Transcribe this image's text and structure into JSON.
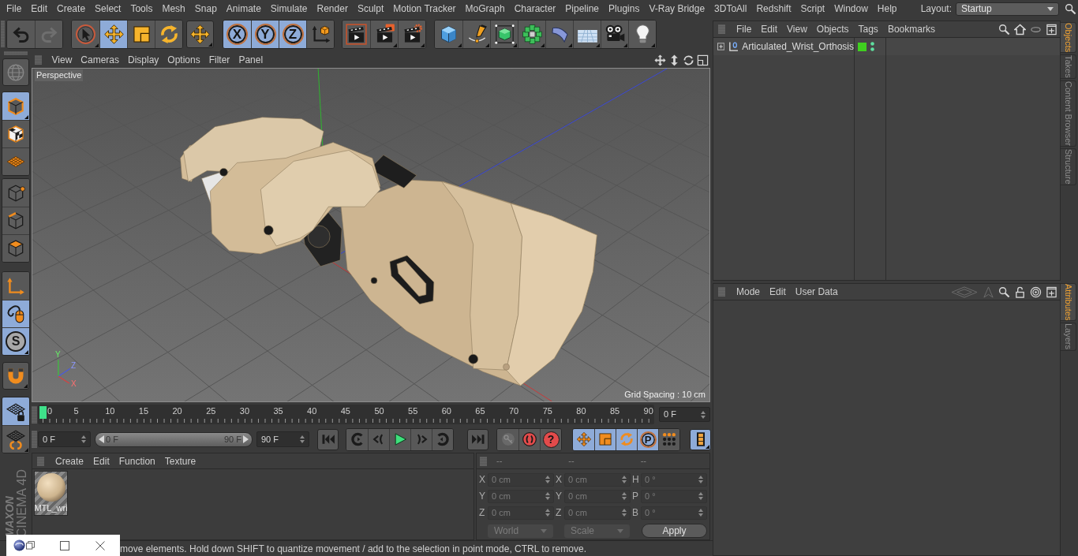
{
  "menu_bar": {
    "items": [
      "File",
      "Edit",
      "Create",
      "Select",
      "Tools",
      "Mesh",
      "Snap",
      "Animate",
      "Simulate",
      "Render",
      "Sculpt",
      "Motion Tracker",
      "MoGraph",
      "Character",
      "Pipeline",
      "Plugins",
      "V-Ray Bridge",
      "3DToAll",
      "Redshift",
      "Script",
      "Window",
      "Help"
    ],
    "layout_label": "Layout:",
    "layout_value": "Startup"
  },
  "toolbar": {
    "groups": [
      {
        "buttons": [
          {
            "kind": "undo",
            "selected": false,
            "disabled": false
          },
          {
            "kind": "redo",
            "selected": false,
            "disabled": true
          }
        ]
      },
      {
        "buttons": [
          {
            "kind": "live-select",
            "selected": false,
            "disabled": false
          },
          {
            "kind": "move",
            "selected": true,
            "disabled": false
          },
          {
            "kind": "scale",
            "selected": false,
            "disabled": false
          },
          {
            "kind": "rotate",
            "selected": false,
            "disabled": false
          }
        ]
      },
      {
        "buttons": [
          {
            "kind": "move-menu",
            "selected": false,
            "disabled": false
          }
        ]
      },
      {
        "buttons": [
          {
            "kind": "axis-lock",
            "label": "X",
            "selected": true,
            "disabled": false
          },
          {
            "kind": "axis-lock",
            "label": "Y",
            "selected": true,
            "disabled": false
          },
          {
            "kind": "axis-lock",
            "label": "Z",
            "selected": true,
            "disabled": false
          },
          {
            "kind": "coordinate-system",
            "selected": false,
            "disabled": false
          }
        ]
      },
      {
        "buttons": [
          {
            "kind": "render-view",
            "selected": false,
            "disabled": false
          },
          {
            "kind": "render-picture-viewer",
            "selected": false,
            "disabled": false
          },
          {
            "kind": "render-settings",
            "selected": false,
            "disabled": false
          }
        ]
      },
      {
        "buttons": [
          {
            "kind": "cube",
            "selected": false,
            "disabled": false
          },
          {
            "kind": "pen",
            "selected": false,
            "disabled": false
          },
          {
            "kind": "subdivision",
            "selected": false,
            "disabled": false
          },
          {
            "kind": "cloner",
            "selected": false,
            "disabled": false
          },
          {
            "kind": "deformer",
            "selected": false,
            "disabled": false
          },
          {
            "kind": "floor",
            "selected": false,
            "disabled": false
          },
          {
            "kind": "camera",
            "selected": false,
            "disabled": false
          },
          {
            "kind": "light",
            "selected": false,
            "disabled": false
          }
        ]
      }
    ]
  },
  "mode_toolbar": {
    "groups": [
      {
        "buttons": [
          {
            "kind": "make-editable",
            "selected": false,
            "disabled": true
          }
        ]
      },
      {
        "buttons": [
          {
            "kind": "model",
            "selected": true,
            "disabled": false
          },
          {
            "kind": "texture",
            "selected": false,
            "disabled": false
          },
          {
            "kind": "workplane",
            "selected": false,
            "disabled": false
          }
        ]
      },
      {
        "buttons": [
          {
            "kind": "points",
            "selected": false,
            "disabled": false
          },
          {
            "kind": "edges",
            "selected": false,
            "disabled": false
          },
          {
            "kind": "polygons",
            "selected": false,
            "disabled": false
          }
        ]
      },
      {
        "buttons": [
          {
            "kind": "axis",
            "selected": false,
            "disabled": false
          },
          {
            "kind": "tweak",
            "selected": true,
            "disabled": false
          },
          {
            "kind": "snap",
            "label": "S",
            "selected": true,
            "disabled": false
          }
        ]
      },
      {
        "buttons": [
          {
            "kind": "magnet",
            "selected": false,
            "disabled": false
          }
        ]
      },
      {
        "buttons": [
          {
            "kind": "workplane-lock",
            "selected": true,
            "disabled": false
          },
          {
            "kind": "workplane-rotate",
            "selected": false,
            "disabled": false
          }
        ]
      }
    ]
  },
  "logo": {
    "brand": "MAXON",
    "product": "CINEMA 4D"
  },
  "viewport": {
    "menus": [
      "View",
      "Cameras",
      "Display",
      "Options",
      "Filter",
      "Panel"
    ],
    "camera": "Perspective",
    "grid_spacing": "Grid Spacing : 10 cm",
    "axis_labels": {
      "y": "Y",
      "z": "Z",
      "x": "X"
    }
  },
  "timeline": {
    "frame_labels": [
      "0",
      "5",
      "10",
      "15",
      "20",
      "25",
      "30",
      "35",
      "40",
      "45",
      "50",
      "55",
      "60",
      "65",
      "70",
      "75",
      "80",
      "85",
      "90"
    ],
    "playhead": {
      "level": 0
    },
    "current_frame": "0 F"
  },
  "transport": {
    "start_frame": "0 F",
    "range_start": "0 F",
    "range_end": "90 F",
    "end_frame": "90 F",
    "groups": [
      {
        "buttons": [
          {
            "kind": "go-start",
            "selected": false,
            "disabled": false
          }
        ]
      },
      {
        "buttons": [
          {
            "kind": "prev-key",
            "selected": false,
            "disabled": false
          },
          {
            "kind": "prev-frame",
            "selected": false,
            "disabled": false
          },
          {
            "kind": "play",
            "selected": false,
            "disabled": false
          },
          {
            "kind": "next-frame",
            "selected": false,
            "disabled": false
          },
          {
            "kind": "next-key",
            "selected": false,
            "disabled": false
          }
        ]
      },
      {
        "buttons": [
          {
            "kind": "go-end",
            "selected": false,
            "disabled": false
          }
        ]
      },
      {
        "buttons": [
          {
            "kind": "record-key",
            "selected": false,
            "disabled": true
          },
          {
            "kind": "autokey",
            "selected": false,
            "disabled": false
          },
          {
            "kind": "help",
            "label": "?",
            "selected": false,
            "disabled": false
          }
        ]
      },
      {
        "buttons": [
          {
            "kind": "key-move",
            "selected": true,
            "disabled": false
          },
          {
            "kind": "key-scale",
            "selected": true,
            "disabled": false
          },
          {
            "kind": "key-rotate",
            "selected": true,
            "disabled": false
          },
          {
            "kind": "param",
            "label": "P",
            "selected": true,
            "disabled": false
          },
          {
            "kind": "point-level",
            "selected": false,
            "disabled": false
          }
        ]
      },
      {
        "buttons": [
          {
            "kind": "timeline-window",
            "selected": true,
            "disabled": false
          }
        ]
      }
    ]
  },
  "material_manager": {
    "menus": [
      "Create",
      "Edit",
      "Function",
      "Texture"
    ],
    "materials": [
      {
        "name": "MTL_wri"
      }
    ]
  },
  "coordinates": {
    "headers": [
      "--",
      "--",
      "--"
    ],
    "rows": [
      {
        "cells": [
          {
            "label": "X",
            "value": "0 cm"
          },
          {
            "label": "X",
            "value": "0 cm"
          },
          {
            "label": "H",
            "value": "0 °"
          }
        ]
      },
      {
        "cells": [
          {
            "label": "Y",
            "value": "0 cm"
          },
          {
            "label": "Y",
            "value": "0 cm"
          },
          {
            "label": "P",
            "value": "0 °"
          }
        ]
      },
      {
        "cells": [
          {
            "label": "Z",
            "value": "0 cm"
          },
          {
            "label": "Z",
            "value": "0 cm"
          },
          {
            "label": "B",
            "value": "0 °"
          }
        ]
      }
    ],
    "mode": "World",
    "size_mode": "Scale",
    "apply": "Apply"
  },
  "status_bar": {
    "text": "move elements. Hold down SHIFT to quantize movement / add to the selection in point mode, CTRL to remove."
  },
  "object_manager": {
    "menus": [
      "File",
      "Edit",
      "View",
      "Objects",
      "Tags",
      "Bookmarks"
    ],
    "objects": [
      {
        "name": "Articulated_Wrist_Orthosis",
        "expanded": false
      }
    ],
    "tabs": [
      {
        "label": "Objects",
        "selected": true
      },
      {
        "label": "Takes",
        "selected": false
      },
      {
        "label": "Content Browser",
        "selected": false
      },
      {
        "label": "Structure",
        "selected": false
      }
    ]
  },
  "attribute_manager": {
    "menus": [
      "Mode",
      "Edit",
      "User Data"
    ],
    "tabs": [
      {
        "label": "Attributes",
        "selected": true
      },
      {
        "label": "Layers",
        "selected": false
      }
    ]
  }
}
